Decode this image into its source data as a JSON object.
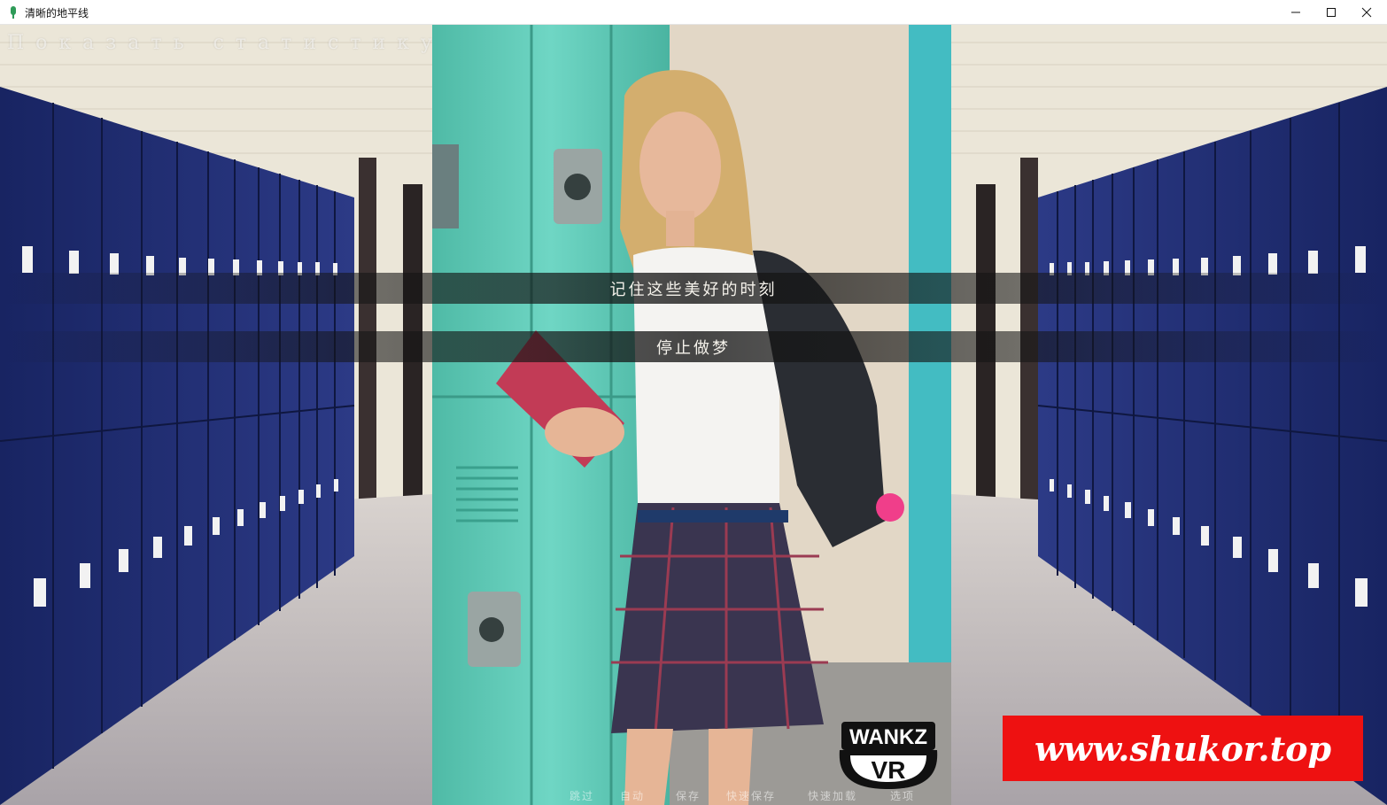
{
  "window": {
    "title": "清晰的地平线",
    "icon": "app-icon",
    "controls": {
      "minimize": "minimize-icon",
      "maximize": "maximize-icon",
      "close": "close-icon"
    }
  },
  "game": {
    "stats_link": "Показать статистику",
    "choices": [
      {
        "label": "记住这些美好的时刻"
      },
      {
        "label": "停止做梦"
      }
    ],
    "quick_menu": [
      "跳过",
      "自动",
      "保存",
      "快速保存",
      "快速加载",
      "选项"
    ],
    "logo": {
      "line1": "WANKZ",
      "line2": "VR"
    },
    "watermark": "www.shukor.top"
  },
  "colors": {
    "locker_blue": "#1f2d74",
    "locker_teal": "#5ec9b5",
    "floor": "#cfc8c4",
    "watermark_red": "#ee1111"
  }
}
